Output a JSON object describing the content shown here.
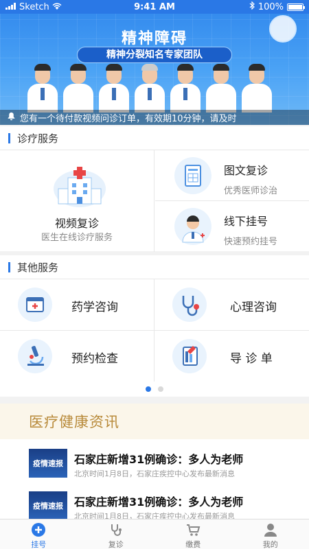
{
  "status_bar": {
    "carrier": "Sketch",
    "time": "9:41 AM",
    "battery": "100%"
  },
  "banner": {
    "title": "精神障碍",
    "subtitle": "精神分裂知名专家团队",
    "notice": "您有一个待付款视频问诊订单，有效期10分钟，请及时"
  },
  "diagnosis_section": {
    "heading": "诊疗服务",
    "main": {
      "title": "视频复诊",
      "desc": "医生在线诊疗服务"
    },
    "side": [
      {
        "title": "图文复诊",
        "desc": "优秀医师诊治"
      },
      {
        "title": "线下挂号",
        "desc": "快速预约挂号"
      }
    ]
  },
  "other_section": {
    "heading": "其他服务",
    "items": [
      {
        "label": "药学咨询",
        "icon": "medicine-box-icon"
      },
      {
        "label": "心理咨询",
        "icon": "stethoscope-icon"
      },
      {
        "label": "预约检查",
        "icon": "microscope-icon"
      },
      {
        "label": "导 诊 单",
        "icon": "document-icon"
      }
    ]
  },
  "pager": {
    "count": 2,
    "active": 0
  },
  "news": {
    "heading": "医疗健康资讯",
    "items": [
      {
        "thumb": "疫情速报",
        "title": "石家庄新增31例确诊：多人为老师",
        "desc": "北京时间1月8日，石家庄疾控中心发布最新消息"
      },
      {
        "thumb": "疫情速报",
        "title": "石家庄新增31例确诊：多人为老师",
        "desc": "北京时间1月8日，石家庄疾控中心发布最新消息"
      }
    ]
  },
  "tabbar": {
    "tabs": [
      {
        "label": "挂号",
        "active": true
      },
      {
        "label": "复诊",
        "active": false
      },
      {
        "label": "缴费",
        "active": false
      },
      {
        "label": "我的",
        "active": false
      }
    ]
  },
  "colors": {
    "primary": "#2a78e6",
    "news_gold": "#b88a3a"
  }
}
